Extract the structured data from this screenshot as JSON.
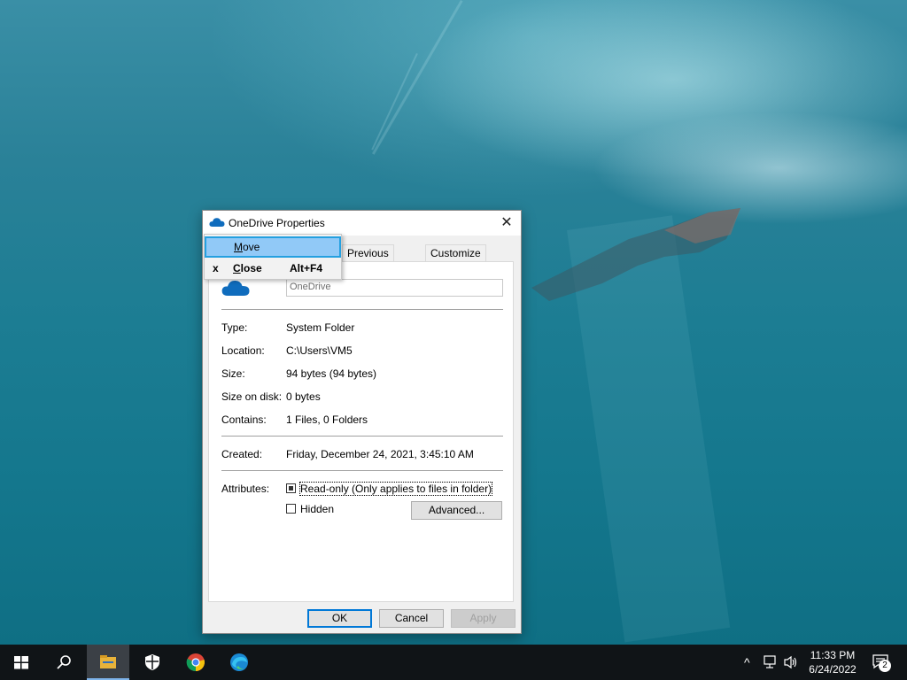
{
  "window": {
    "title": "OneDrive Properties",
    "close_label": "✕",
    "tabs": [
      {
        "label": "Previous Versions"
      },
      {
        "label": "Customize"
      }
    ],
    "name_value": "OneDrive",
    "fields": {
      "type_label": "Type:",
      "type_value": "System Folder",
      "location_label": "Location:",
      "location_value": "C:\\Users\\VM5",
      "size_label": "Size:",
      "size_value": "94 bytes (94 bytes)",
      "size_on_disk_label": "Size on disk:",
      "size_on_disk_value": "0 bytes",
      "contains_label": "Contains:",
      "contains_value": "1 Files, 0 Folders",
      "created_label": "Created:",
      "created_value": "Friday, December 24, 2021, 3:45:10 AM",
      "attributes_label": "Attributes:"
    },
    "attributes": {
      "readonly_label": "Read-only (Only applies to files in folder)",
      "readonly_state": "indeterminate",
      "hidden_label": "Hidden",
      "hidden_checked": false,
      "advanced_label": "Advanced..."
    },
    "buttons": {
      "ok": "OK",
      "cancel": "Cancel",
      "apply": "Apply"
    }
  },
  "context_menu": {
    "items": [
      {
        "label": "Move",
        "glyph": "",
        "accel": "",
        "highlighted": true
      },
      {
        "label": "Close",
        "glyph": "x",
        "accel": "Alt+F4",
        "highlighted": false
      }
    ]
  },
  "taskbar": {
    "apps": [
      {
        "icon": "windows-start-icon"
      },
      {
        "icon": "search-icon"
      },
      {
        "icon": "file-explorer-icon",
        "active": true
      },
      {
        "icon": "windows-security-icon"
      },
      {
        "icon": "chrome-icon"
      },
      {
        "icon": "edge-icon"
      }
    ],
    "tray": {
      "chevron": "^",
      "time": "11:33 PM",
      "date": "6/24/2022",
      "notification_count": "2"
    }
  },
  "colors": {
    "accent": "#0078d7",
    "menu_highlight": "#91c9f7",
    "taskbar": "#101417"
  }
}
